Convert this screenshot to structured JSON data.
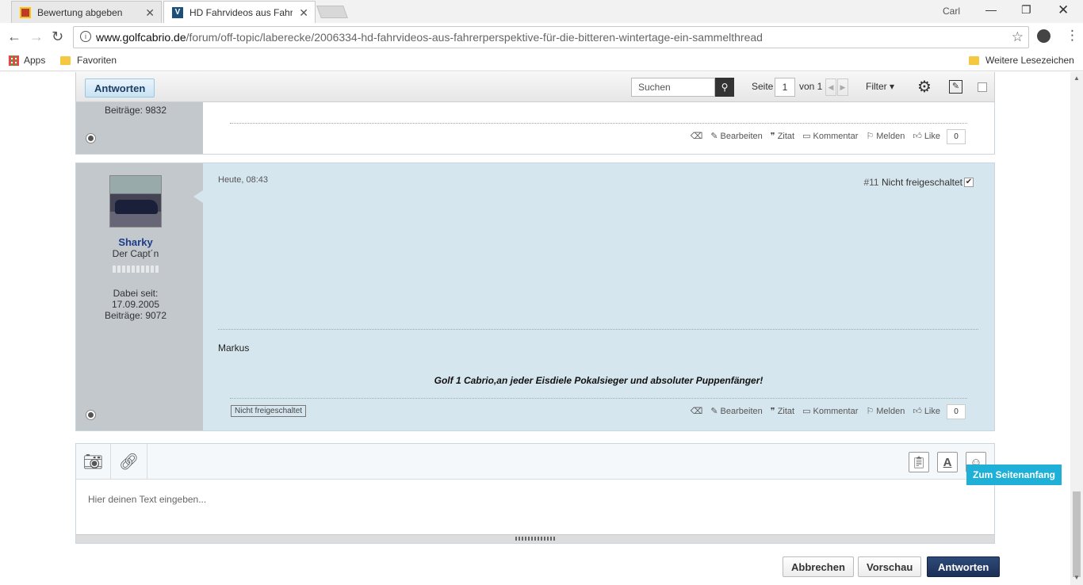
{
  "browser": {
    "tabs": [
      {
        "title": "Bewertung abgeben",
        "active": false
      },
      {
        "title": "HD Fahrvideos aus Fahre",
        "active": true
      }
    ],
    "user_label": "Carl",
    "url_host": "www.golfcabrio.de",
    "url_path": "/forum/off-topic/laberecke/2006334-hd-fahrvideos-aus-fahrerperspektive-für-die-bitteren-wintertage-ein-sammelthread",
    "bookmarks": {
      "apps": "Apps",
      "favoriten": "Favoriten",
      "weitere": "Weitere Lesezeichen"
    }
  },
  "toolbar": {
    "reply_label": "Antworten",
    "search_placeholder": "Suchen",
    "page_label": "Seite",
    "page_current": "1",
    "page_of": "von 1",
    "filter_label": "Filter"
  },
  "posts": [
    {
      "author_posts": "Beiträge: 9832",
      "actions": {
        "edit": "Bearbeiten",
        "quote": "Zitat",
        "comment": "Kommentar",
        "report": "Melden",
        "like": "Like",
        "like_count": "0"
      }
    },
    {
      "timestamp": "Heute, 08:43",
      "post_number": "#11",
      "status": "Nicht freigeschaltet",
      "author_name": "Sharky",
      "author_title": "Der Capt´n",
      "joined_label": "Dabei seit:",
      "joined_date": "17.09.2005",
      "author_posts": "Beiträge: 9072",
      "content_name": "Markus",
      "signature": "Golf 1 Cabrio,an jeder Eisdiele Pokalsieger und absoluter Puppenfänger!",
      "unapproved_badge": "Nicht freigeschaltet",
      "actions": {
        "edit": "Bearbeiten",
        "quote": "Zitat",
        "comment": "Kommentar",
        "report": "Melden",
        "like": "Like",
        "like_count": "0"
      }
    }
  ],
  "editor": {
    "placeholder": "Hier deinen Text eingeben...",
    "cancel_label": "Abbrechen",
    "preview_label": "Vorschau",
    "submit_label": "Antworten"
  },
  "to_top_label": "Zum Seitenanfang"
}
